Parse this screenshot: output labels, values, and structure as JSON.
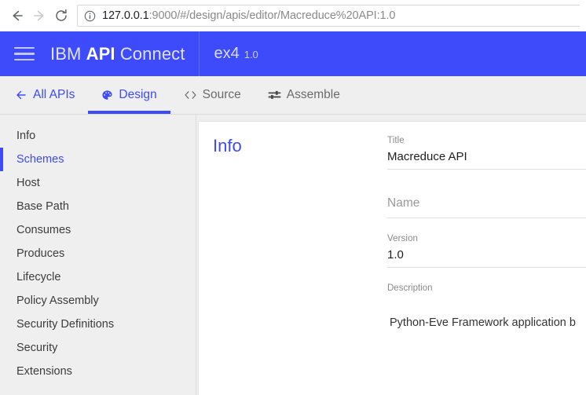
{
  "browser": {
    "back_icon": "arrow-left-icon",
    "forward_icon": "arrow-right-icon",
    "reload_icon": "reload-icon",
    "info_icon": "info-circle-icon",
    "url_host": "127.0.0.1",
    "url_rest": ":9000/#/design/apis/editor/Macreduce%20API:1.0",
    "url_full": "127.0.0.1:9000/#/design/apis/editor/Macreduce%20API:1.0"
  },
  "header": {
    "menu_icon": "hamburger-menu-icon",
    "brand_prefix": "IBM ",
    "brand_bold": "API",
    "brand_suffix": " Connect",
    "api_name": "ex4",
    "api_version": "1.0"
  },
  "tabs": [
    {
      "label": "All APIs",
      "icon": "arrow-left-icon",
      "state": "link"
    },
    {
      "label": "Design",
      "icon": "palette-icon",
      "state": "active"
    },
    {
      "label": "Source",
      "icon": "code-brackets-icon",
      "state": "inactive"
    },
    {
      "label": "Assemble",
      "icon": "sliders-icon",
      "state": "inactive"
    }
  ],
  "sidebar": {
    "items": [
      {
        "label": "Info",
        "active": false
      },
      {
        "label": "Schemes",
        "active": true
      },
      {
        "label": "Host",
        "active": false
      },
      {
        "label": "Base Path",
        "active": false
      },
      {
        "label": "Consumes",
        "active": false
      },
      {
        "label": "Produces",
        "active": false
      },
      {
        "label": "Lifecycle",
        "active": false
      },
      {
        "label": "Policy Assembly",
        "active": false
      },
      {
        "label": "Security Definitions",
        "active": false
      },
      {
        "label": "Security",
        "active": false
      },
      {
        "label": "Extensions",
        "active": false
      }
    ]
  },
  "main": {
    "section_title": "Info",
    "fields": {
      "title_label": "Title",
      "title_value": "Macreduce API",
      "name_label": "Name",
      "version_label": "Version",
      "version_value": "1.0",
      "description_label": "Description",
      "description_value": "Python-Eve Framework application b"
    }
  },
  "colors": {
    "brand_blue": "#3d4bfa",
    "tab_bar_bg": "#efefef",
    "sidebar_bg": "#efefef",
    "card_bg": "#ffffff",
    "muted_text": "#8a8a8a"
  }
}
